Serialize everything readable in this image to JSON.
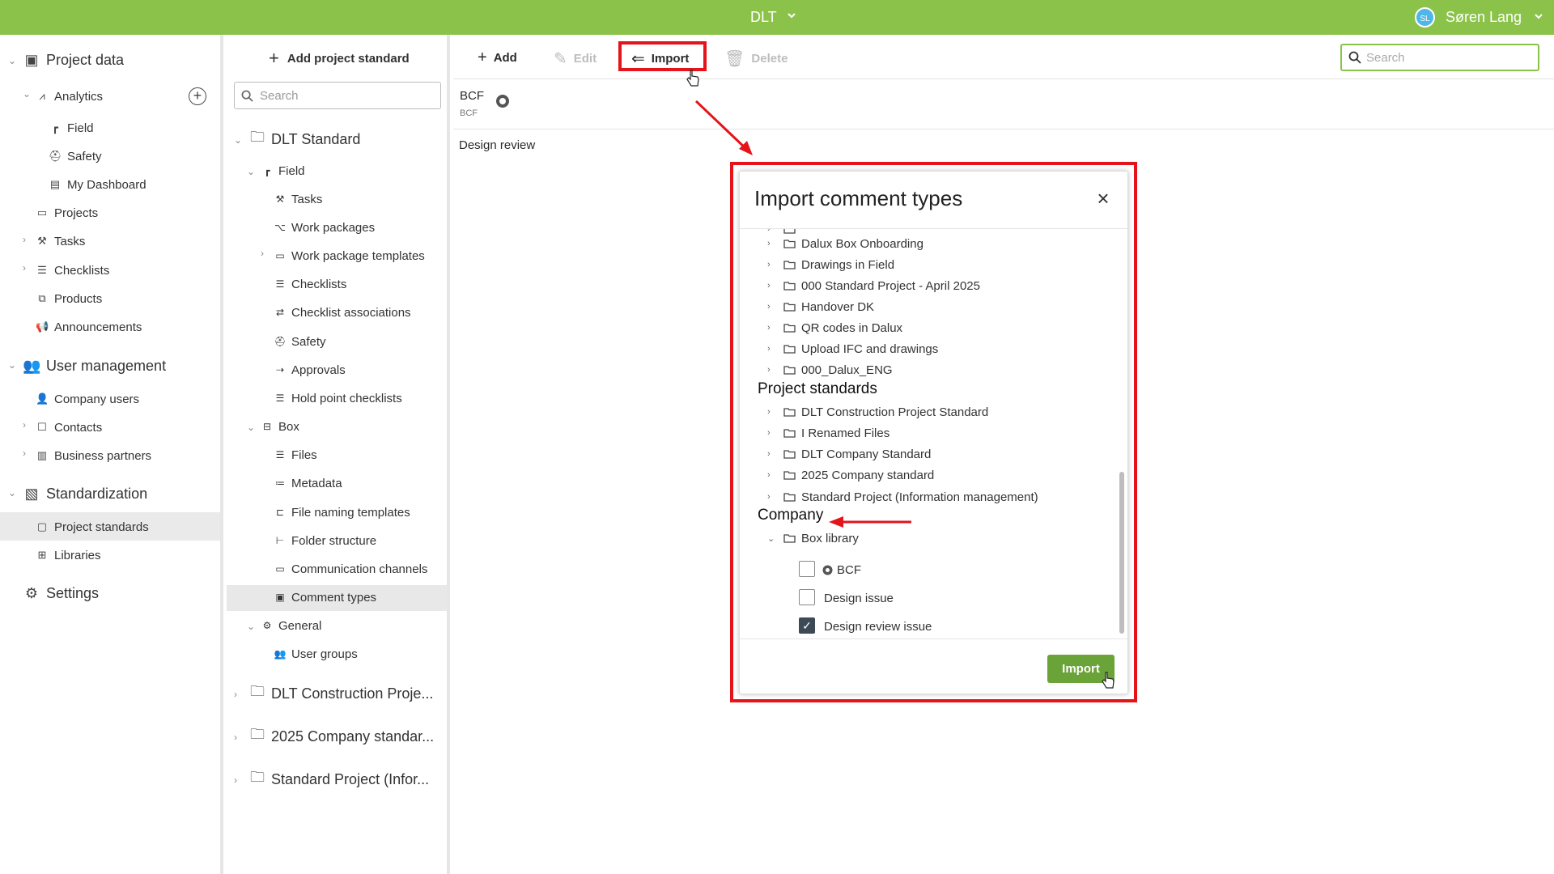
{
  "topbar": {
    "project": "DLT",
    "avatar_initials": "SL",
    "user": "Søren Lang"
  },
  "nav": {
    "project_data": "Project data",
    "analytics": "Analytics",
    "field": "Field",
    "safety": "Safety",
    "my_dashboard": "My Dashboard",
    "projects": "Projects",
    "tasks": "Tasks",
    "checklists": "Checklists",
    "products": "Products",
    "announcements": "Announcements",
    "user_management": "User management",
    "company_users": "Company users",
    "contacts": "Contacts",
    "business_partners": "Business partners",
    "standardization": "Standardization",
    "project_standards": "Project standards",
    "libraries": "Libraries",
    "settings": "Settings"
  },
  "tree": {
    "add_label": "Add project standard",
    "search_placeholder": "Search",
    "dlt_standard": "DLT Standard",
    "field": "Field",
    "tasks": "Tasks",
    "work_packages": "Work packages",
    "work_package_templates": "Work package templates",
    "checklists": "Checklists",
    "checklist_associations": "Checklist associations",
    "safety": "Safety",
    "approvals": "Approvals",
    "hold_point_checklists": "Hold point checklists",
    "box": "Box",
    "files": "Files",
    "metadata": "Metadata",
    "file_naming_templates": "File naming templates",
    "folder_structure": "Folder structure",
    "communication_channels": "Communication channels",
    "comment_types": "Comment types",
    "general": "General",
    "user_groups": "User groups",
    "dlt_construction": "DLT Construction Proje...",
    "company_2025": "2025 Company standar...",
    "standard_project": "Standard Project (Infor..."
  },
  "toolbar": {
    "add": "Add",
    "edit": "Edit",
    "import": "Import",
    "delete": "Delete",
    "search_placeholder": "Search"
  },
  "list": {
    "bcf_title": "BCF",
    "bcf_sub": "BCF",
    "design_review": "Design review"
  },
  "modal": {
    "title": "Import comment types",
    "projects": [
      "Dalux Box Onboarding",
      "Drawings in Field",
      "000 Standard Project - April 2025",
      "Handover DK",
      "QR codes in Dalux",
      "Upload IFC and drawings",
      "000_Dalux_ENG"
    ],
    "project_standards_heading": "Project standards",
    "project_standards": [
      "DLT Construction Project Standard",
      "I Renamed Files",
      "DLT Company Standard",
      "2025 Company standard",
      "Standard Project (Information management)"
    ],
    "company_heading": "Company",
    "box_library": "Box library",
    "items": [
      {
        "label": "BCF",
        "checked": false
      },
      {
        "label": "Design issue",
        "checked": false
      },
      {
        "label": "Design review issue",
        "checked": true
      }
    ],
    "import_button": "Import"
  },
  "colors": {
    "brand_green": "#8bc34a",
    "button_green": "#6aa338",
    "highlight_red": "#e4141a"
  }
}
